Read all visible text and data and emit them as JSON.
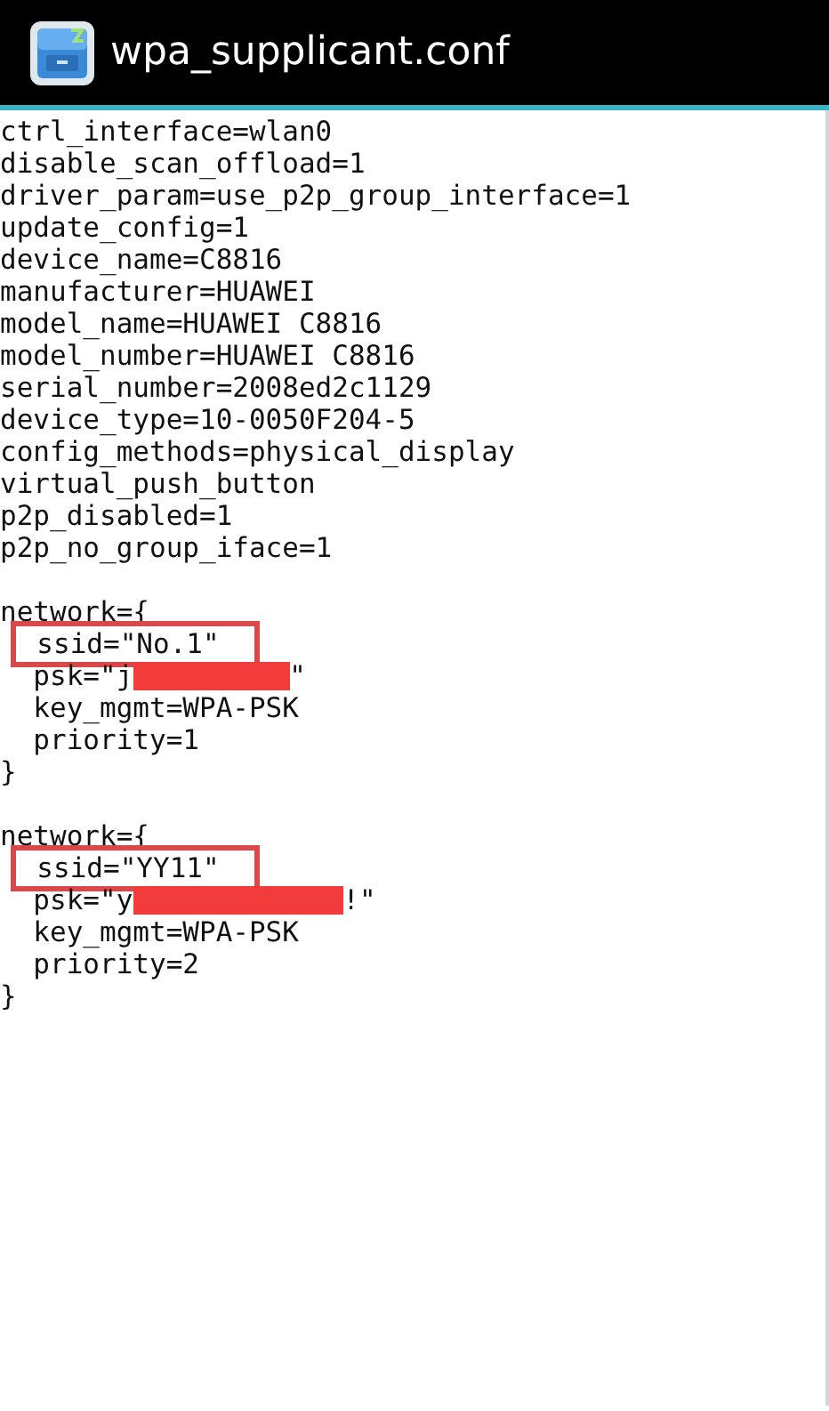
{
  "window": {
    "title": "wpa_supplicant.conf"
  },
  "lines": [
    {
      "kind": "text",
      "text": "ctrl_interface=wlan0",
      "highlighted": false
    },
    {
      "kind": "text",
      "text": "disable_scan_offload=1",
      "highlighted": false
    },
    {
      "kind": "text",
      "text": "driver_param=use_p2p_group_interface=1",
      "highlighted": false
    },
    {
      "kind": "text",
      "text": "update_config=1",
      "highlighted": false
    },
    {
      "kind": "text",
      "text": "device_name=C8816",
      "highlighted": false
    },
    {
      "kind": "text",
      "text": "manufacturer=HUAWEI",
      "highlighted": false
    },
    {
      "kind": "text",
      "text": "model_name=HUAWEI C8816",
      "highlighted": false
    },
    {
      "kind": "text",
      "text": "model_number=HUAWEI C8816",
      "highlighted": false
    },
    {
      "kind": "text",
      "text": "serial_number=2008ed2c1129",
      "highlighted": false
    },
    {
      "kind": "text",
      "text": "device_type=10-0050F204-5",
      "highlighted": false
    },
    {
      "kind": "text",
      "text": "config_methods=physical_display",
      "highlighted": false
    },
    {
      "kind": "text",
      "text": "virtual_push_button",
      "highlighted": false
    },
    {
      "kind": "text",
      "text": "p2p_disabled=1",
      "highlighted": false
    },
    {
      "kind": "text",
      "text": "p2p_no_group_iface=1",
      "highlighted": false
    },
    {
      "kind": "blank"
    },
    {
      "kind": "text",
      "text": "network={",
      "highlighted": false
    },
    {
      "kind": "text",
      "text": "  ssid=\"No.1\"",
      "highlighted": true
    },
    {
      "kind": "redacted",
      "text": "  psk=\"j",
      "suffix": "\"",
      "highlighted": false
    },
    {
      "kind": "text",
      "text": "  key_mgmt=WPA-PSK",
      "highlighted": false
    },
    {
      "kind": "text",
      "text": "  priority=1",
      "highlighted": false
    },
    {
      "kind": "text",
      "text": "}",
      "highlighted": false
    },
    {
      "kind": "blank"
    },
    {
      "kind": "text",
      "text": "network={",
      "highlighted": false
    },
    {
      "kind": "text",
      "text": "  ssid=\"YY11\"",
      "highlighted": true
    },
    {
      "kind": "redacted",
      "text": "  psk=\"y",
      "suffix": "!\"",
      "highlighted": false
    },
    {
      "kind": "text",
      "text": "  key_mgmt=WPA-PSK",
      "highlighted": false
    },
    {
      "kind": "text",
      "text": "  priority=2",
      "highlighted": false
    },
    {
      "kind": "text",
      "text": "}",
      "highlighted": false
    }
  ]
}
